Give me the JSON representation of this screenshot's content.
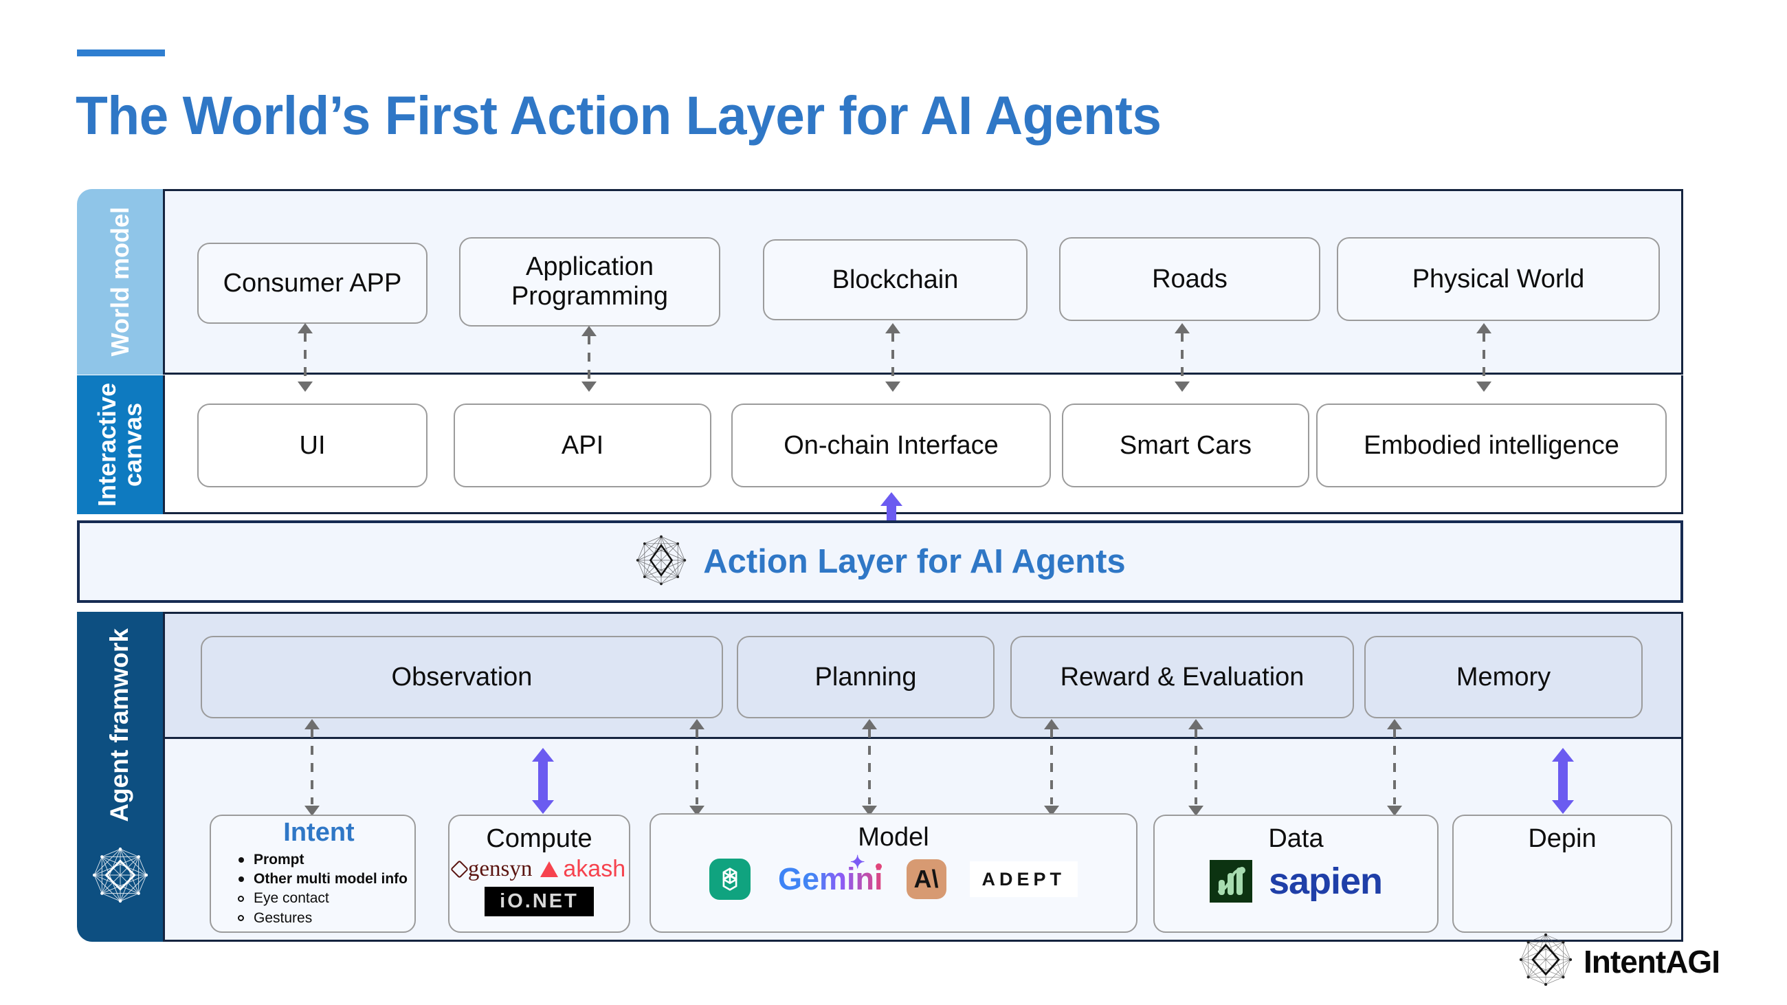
{
  "title": "The World’s First Action Layer for AI Agents",
  "accent_color": "#2f77c6",
  "rails": {
    "world": "World model",
    "canvas": "Interactive canvas",
    "agent": "Agent framwork"
  },
  "world_model": {
    "nodes": [
      "Consumer APP",
      "Application Programming",
      "Blockchain",
      "Roads",
      "Physical World"
    ]
  },
  "interactive_canvas": {
    "nodes": [
      "UI",
      "API",
      "On-chain Interface",
      "Smart Cars",
      "Embodied intelligence"
    ]
  },
  "action_layer": {
    "label": "Action Layer for AI Agents"
  },
  "agent_framework": {
    "nodes": [
      "Observation",
      "Planning",
      "Reward & Evaluation",
      "Memory"
    ]
  },
  "infrastructure": {
    "intent": {
      "title": "Intent",
      "items": [
        {
          "text": "Prompt",
          "bullet": "filled",
          "bold": true
        },
        {
          "text": "Other multi model info",
          "bullet": "filled",
          "bold": true
        },
        {
          "text": "Eye contact",
          "bullet": "hollow",
          "bold": false
        },
        {
          "text": "Gestures",
          "bullet": "hollow",
          "bold": false
        }
      ]
    },
    "compute": {
      "title": "Compute",
      "logos": [
        "gensyn",
        "akash",
        "io.net"
      ]
    },
    "model": {
      "title": "Model",
      "logos": [
        "OpenAI",
        "Gemini",
        "Anthropic",
        "ADEPT"
      ]
    },
    "data": {
      "title": "Data",
      "logos": [
        "sapien"
      ]
    },
    "depin": {
      "title": "Depin"
    }
  },
  "brand": {
    "name": "IntentAGI",
    "logo": "intentagi-network-diamond"
  }
}
